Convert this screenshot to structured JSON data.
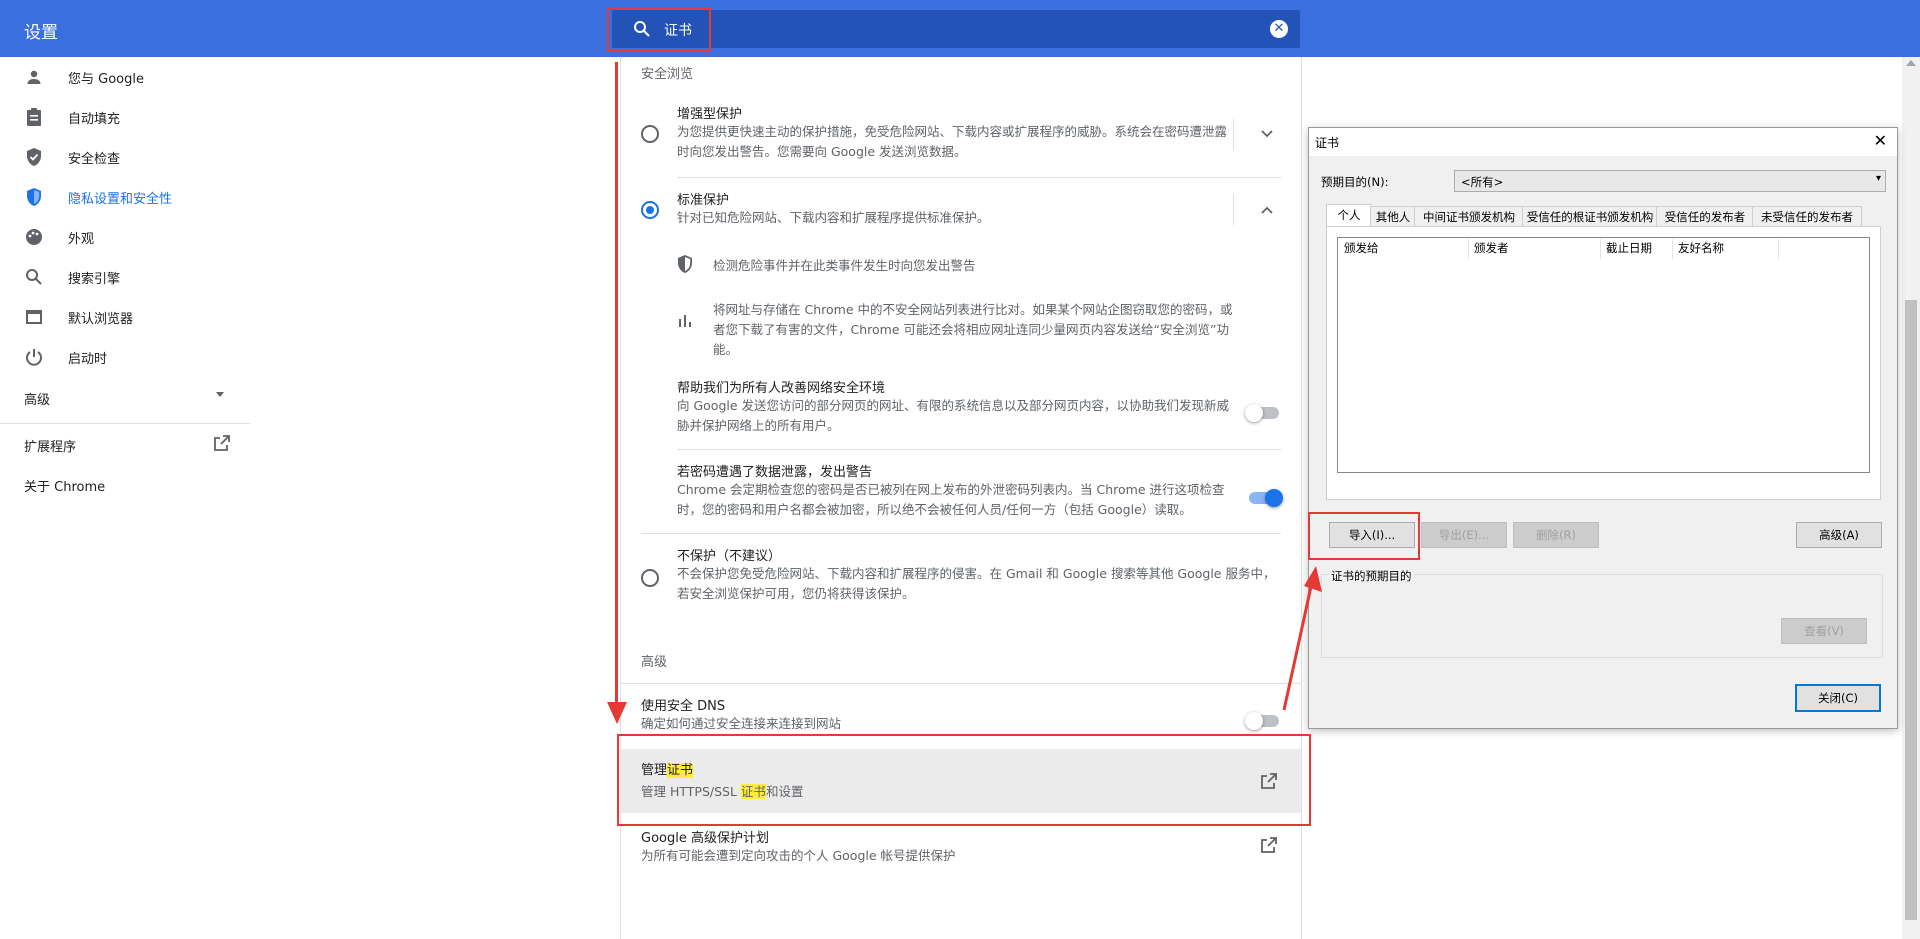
{
  "header": {
    "title": "设置",
    "search_value": "证书"
  },
  "sidebar": {
    "items": [
      {
        "label": "您与 Google",
        "icon": "person-icon"
      },
      {
        "label": "自动填充",
        "icon": "clipboard-icon"
      },
      {
        "label": "安全检查",
        "icon": "shield-check-icon"
      },
      {
        "label": "隐私设置和安全性",
        "icon": "shield-icon"
      },
      {
        "label": "外观",
        "icon": "palette-icon"
      },
      {
        "label": "搜索引擎",
        "icon": "search-icon"
      },
      {
        "label": "默认浏览器",
        "icon": "browser-icon"
      },
      {
        "label": "启动时",
        "icon": "power-icon"
      }
    ],
    "advanced": "高级",
    "extensions": "扩展程序",
    "about": "关于 Chrome"
  },
  "safe_browsing": {
    "heading": "安全浏览",
    "enhanced": {
      "title": "增强型保护",
      "desc": "为您提供更快速主动的保护措施，免受危险网站、下载内容或扩展程序的威胁。系统会在密码遭泄露时向您发出警告。您需要向 Google 发送浏览数据。"
    },
    "standard": {
      "title": "标准保护",
      "desc": "针对已知危险网站、下载内容和扩展程序提供标准保护。"
    },
    "detect": "检测危险事件并在此类事件发生时向您发出警告",
    "compare": "将网址与存储在 Chrome 中的不安全网站列表进行比对。如果某个网站企图窃取您的密码，或者您下载了有害的文件，Chrome 可能还会将相应网址连同少量网页内容发送给“安全浏览”功能。",
    "help": {
      "title": "帮助我们为所有人改善网络安全环境",
      "desc": "向 Google 发送您访问的部分网页的网址、有限的系统信息以及部分网页内容，以协助我们发现新威胁并保护网络上的所有用户。"
    },
    "leak": {
      "title": "若密码遭遇了数据泄露，发出警告",
      "desc": "Chrome 会定期检查您的密码是否已被列在网上发布的外泄密码列表内。当 Chrome 进行这项检查时，您的密码和用户名都会被加密，所以绝不会被任何人员/任何一方（包括 Google）读取。"
    },
    "none": {
      "title": "不保护（不建议）",
      "desc": "不会保护您免受危险网站、下载内容和扩展程序的侵害。在 Gmail 和 Google 搜索等其他 Google 服务中，若安全浏览保护可用，您仍将获得该保护。"
    }
  },
  "advanced": {
    "heading": "高级",
    "dns": {
      "title": "使用安全 DNS",
      "desc": "确定如何通过安全连接来连接到网站"
    },
    "manage": {
      "title_prefix": "管理",
      "title_hl": "证书",
      "desc_prefix": "管理 HTTPS/SSL ",
      "desc_hl": "证书",
      "desc_suffix": "和设置"
    },
    "gap": {
      "title": "Google 高级保护计划",
      "desc": "为所有可能会遭到定向攻击的个人 Google 帐号提供保护"
    }
  },
  "dialog": {
    "title": "证书",
    "purpose_label": "预期目的(N):",
    "purpose_value": "<所有>",
    "tabs": [
      "个人",
      "其他人",
      "中间证书颁发机构",
      "受信任的根证书颁发机构",
      "受信任的发布者",
      "未受信任的发布者"
    ],
    "columns": [
      "颁发给",
      "颁发者",
      "截止日期",
      "友好名称"
    ],
    "buttons": {
      "import": "导入(I)...",
      "export": "导出(E)...",
      "remove": "删除(R)",
      "advanced": "高级(A)",
      "view": "查看(V)",
      "close": "关闭(C)"
    },
    "group_label": "证书的预期目的"
  }
}
